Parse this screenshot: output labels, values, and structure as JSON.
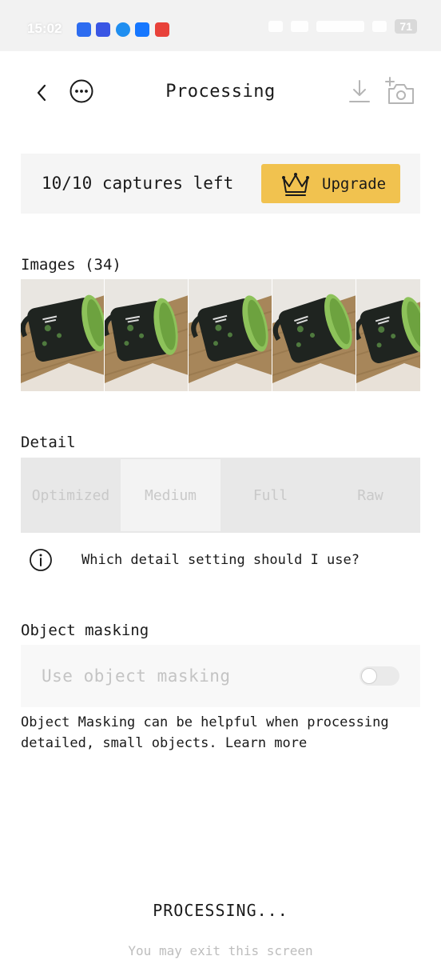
{
  "status_bar": {
    "time": "15:02",
    "battery": "71",
    "app_icons": [
      {
        "name": "messages-icon",
        "color": "#2d6cf0"
      },
      {
        "name": "vivo-icon",
        "color": "#3a56e4"
      },
      {
        "name": "chat-icon",
        "color": "#1f8ef0"
      },
      {
        "name": "alipay-icon",
        "color": "#1677ff"
      },
      {
        "name": "game-icon",
        "color": "#e8423a"
      }
    ]
  },
  "header": {
    "title": "Processing",
    "back_icon": "chevron-left-icon",
    "more_icon": "more-horizontal-icon",
    "download_icon": "download-icon",
    "add_capture_icon": "add-camera-icon"
  },
  "captures": {
    "text": "10/10 captures left",
    "upgrade_label": "Upgrade",
    "upgrade_icon": "crown-icon",
    "accent": "#f1c24f"
  },
  "images": {
    "label": "Images (34)",
    "thumbnails": [
      "mug-capture-1",
      "mug-capture-2",
      "mug-capture-3",
      "mug-capture-4",
      "mug-capture-5"
    ]
  },
  "detail": {
    "label": "Detail",
    "options": [
      "Optimized",
      "Medium",
      "Full",
      "Raw"
    ],
    "selected": "Medium",
    "help_text": "Which detail setting should I use?",
    "help_icon": "info-icon"
  },
  "masking": {
    "label": "Object masking",
    "toggle_label": "Use object masking",
    "toggle_on": false,
    "description_line1": "Object Masking can be helpful when processing",
    "description_line2": "detailed, small objects.",
    "learn_more": "Learn more"
  },
  "footer": {
    "processing": "PROCESSING...",
    "exit_text": "You may exit this screen"
  }
}
